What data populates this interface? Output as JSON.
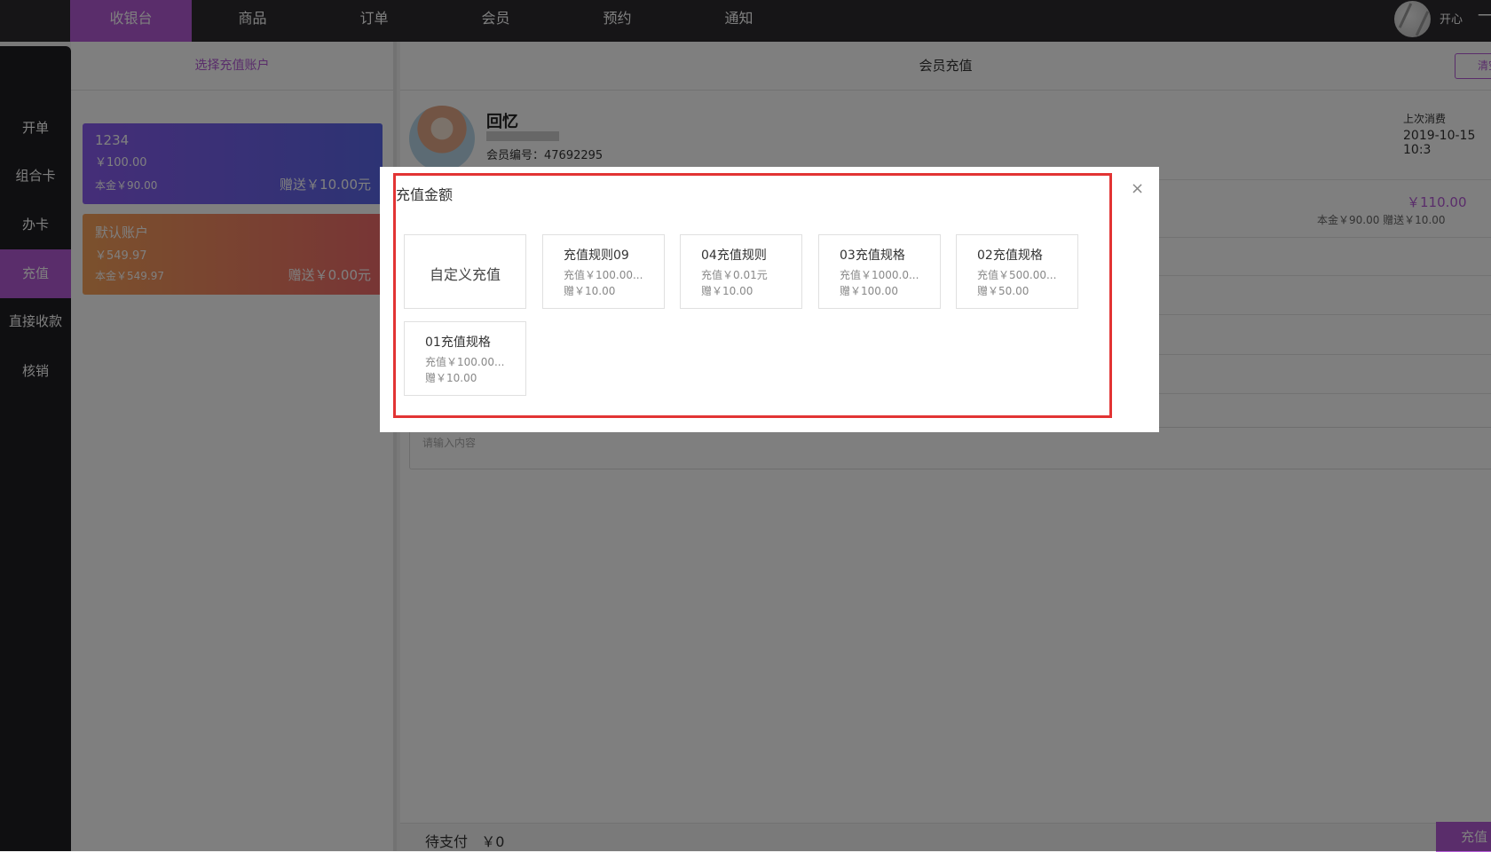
{
  "nav": {
    "items": [
      {
        "label": "收银台",
        "active": true
      },
      {
        "label": "商品"
      },
      {
        "label": "订单"
      },
      {
        "label": "会员"
      },
      {
        "label": "预约"
      },
      {
        "label": "通知"
      }
    ],
    "user_name": "开心",
    "dash": "一"
  },
  "sidebar": {
    "items": [
      {
        "label": "开单"
      },
      {
        "label": "组合卡"
      },
      {
        "label": "办卡"
      },
      {
        "label": "充值",
        "active": true
      },
      {
        "label": "直接收款"
      },
      {
        "label": "核销"
      }
    ]
  },
  "accounts": {
    "header": "选择充值账户",
    "cards": [
      {
        "name": "1234",
        "balance": "￥100.00",
        "principal": "本金￥90.00",
        "gift": "赠送￥10.00元"
      },
      {
        "name": "默认账户",
        "balance": "￥549.97",
        "principal": "本金￥549.97",
        "gift": "赠送￥0.00元"
      }
    ]
  },
  "main": {
    "title": "会员充值",
    "clear_label": "清空",
    "member": {
      "name": "回忆",
      "number": "会员编号：47692295",
      "last_label": "上次消费",
      "last_date": "2019-10-15 10:3"
    },
    "account_amount": "￥110.00",
    "account_detail": "本金￥90.00    赠送￥10.00",
    "remark_placeholder": "请输入内容",
    "pending_label": "待支付",
    "pending_amount": "￥0",
    "pay_label": "充值"
  },
  "dialog": {
    "title": "充值金额",
    "close": "×",
    "custom_label": "自定义充值",
    "options": [
      {
        "title": "充值规则09",
        "charge": "充值￥100.00...",
        "gift": "赠￥10.00"
      },
      {
        "title": "04充值规则",
        "charge": "充值￥0.01元",
        "gift": "赠￥10.00"
      },
      {
        "title": "03充值规格",
        "charge": "充值￥1000.0...",
        "gift": "赠￥100.00"
      },
      {
        "title": "02充值规格",
        "charge": "充值￥500.00...",
        "gift": "赠￥50.00"
      },
      {
        "title": "01充值规格",
        "charge": "充值￥100.00...",
        "gift": "赠￥10.00"
      }
    ]
  },
  "colors": {
    "accent": "#b45ad6",
    "topbar": "#2c2b2f",
    "sidebar": "#1f1e22",
    "highlight": "#e23434"
  }
}
